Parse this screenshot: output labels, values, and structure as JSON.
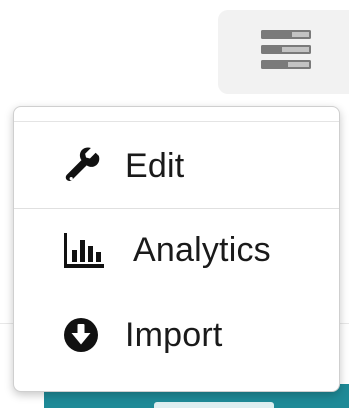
{
  "toolbar": {
    "menu_toggle_icon": "list-menu-icon"
  },
  "dropdown": {
    "items": [
      {
        "label": "Edit",
        "icon": "wrench-icon"
      },
      {
        "label": "Analytics",
        "icon": "bar-chart-icon"
      },
      {
        "label": "Import",
        "icon": "download-circle-icon"
      }
    ]
  },
  "colors": {
    "toggle_background": "#f2f2f2",
    "toggle_icon": "#7a7a7a",
    "accent_button": "#1e8a97",
    "menu_text": "#1a1a1a"
  }
}
